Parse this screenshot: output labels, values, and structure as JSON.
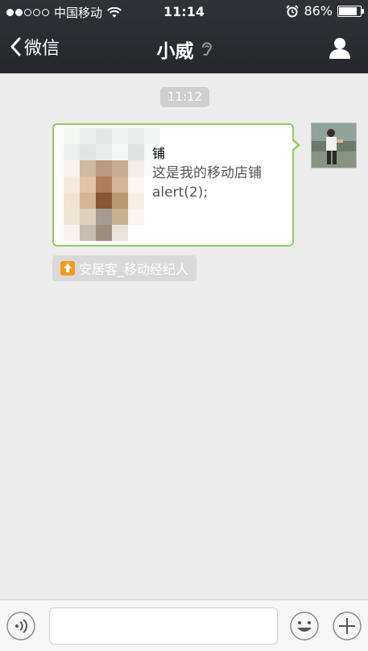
{
  "status_bar": {
    "carrier": "中国移动",
    "time": "11:14",
    "battery": "86%",
    "battery_level": 0.86
  },
  "nav": {
    "back_label": "微信",
    "title": "小威"
  },
  "chat": {
    "timestamp": "11:12",
    "message": {
      "title_fragment": "铺",
      "description": "这是我的移动店铺alert(2);",
      "source_label": "安居客_移动经纪人"
    }
  },
  "colors": {
    "nav_bg": "#2a2c30",
    "chat_bg": "#ececec",
    "bubble_border": "#8ed05e",
    "source_logo": "#f29a1e"
  },
  "icons": {
    "back": "chevron-left-icon",
    "earpiece": "ear-icon",
    "contact": "person-icon",
    "voice": "voice-icon",
    "emoji": "emoji-icon",
    "plus": "plus-icon"
  }
}
